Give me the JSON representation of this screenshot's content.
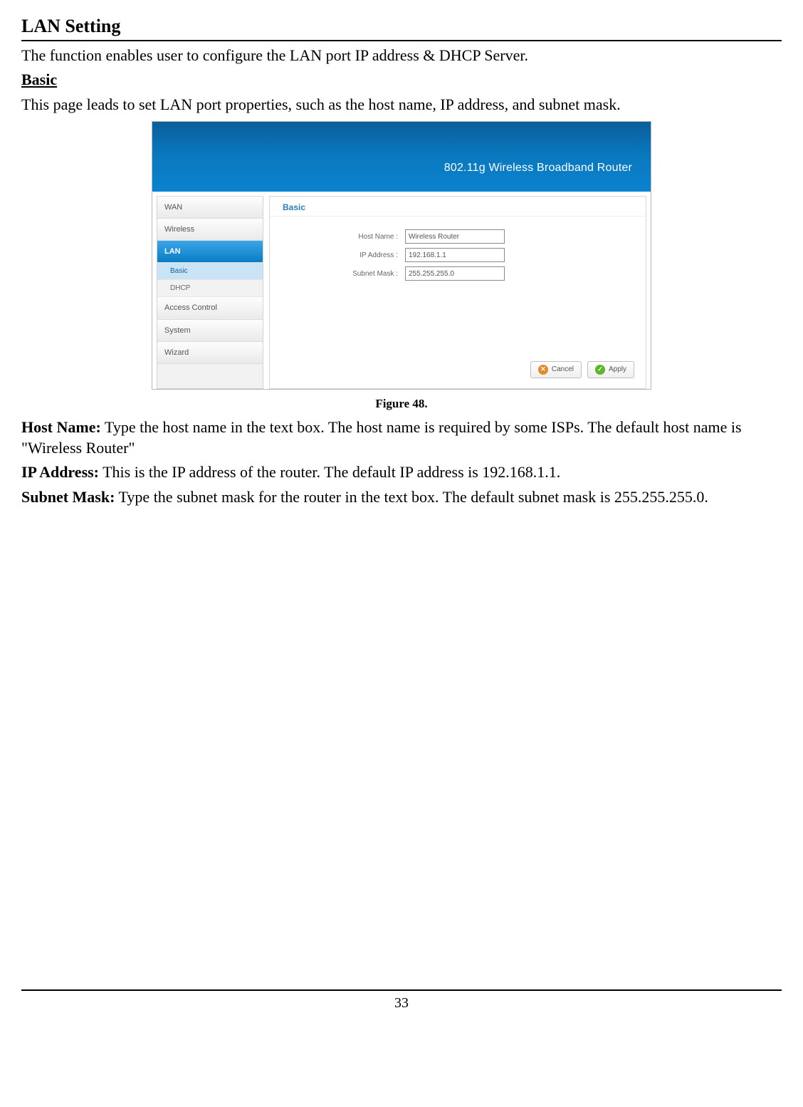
{
  "doc": {
    "title": "LAN Setting",
    "intro": "The function enables user to configure the LAN port IP address & DHCP Server.",
    "section_head": "Basic",
    "section_desc": "This page leads to set LAN port properties, such as the host name, IP address, and subnet mask.",
    "caption": "Figure 48.",
    "host_name_label": "Host Name:",
    "host_name_text": " Type the host name in the text box. The host name is required by some ISPs. The default host name is \"Wireless Router\"",
    "ip_label": "IP Address:",
    "ip_text": " This is the IP address of the router. The default IP address is 192.168.1.1.",
    "subnet_label": "Subnet Mask:",
    "subnet_text": " Type the subnet mask for the router in the text box. The default subnet mask is 255.255.255.0.",
    "page_number": "33"
  },
  "router": {
    "banner": "802.11g Wireless Broadband Router",
    "sidebar": {
      "wan": "WAN",
      "wireless": "Wireless",
      "lan": "LAN",
      "lan_basic": "Basic",
      "lan_dhcp": "DHCP",
      "access": "Access Control",
      "system": "System",
      "wizard": "Wizard"
    },
    "panel": {
      "title": "Basic",
      "host_name_label": "Host Name :",
      "host_name_value": "Wireless Router",
      "ip_label": "IP Address :",
      "ip_value": "192.168.1.1",
      "subnet_label": "Subnet Mask :",
      "subnet_value": "255.255.255.0",
      "cancel": "Cancel",
      "apply": "Apply"
    }
  }
}
